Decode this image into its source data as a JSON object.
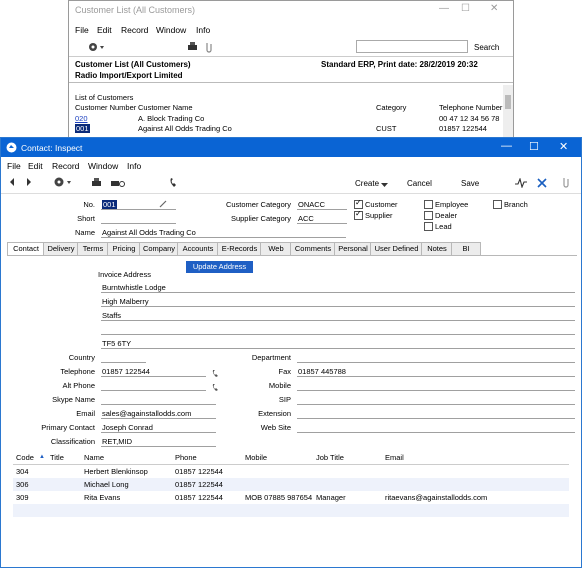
{
  "background_window": {
    "title": "Customer List (All Customers)",
    "menu": [
      "File",
      "Edit",
      "Record",
      "Window",
      "Info"
    ],
    "search_label": "Search",
    "report_title": "Customer List (All Customers)",
    "company": "Radio Import/Export Limited",
    "print_info": "Standard ERP, Print date: 28/2/2019 20:32",
    "list_heading": "List of Customers",
    "columns": [
      "Customer Number",
      "Customer Name",
      "Category",
      "Telephone Number"
    ],
    "rows": [
      {
        "number": "020",
        "name": "A. Block Trading Co",
        "category": "",
        "phone": "00 47 12 34 56 78"
      },
      {
        "number": "001",
        "name": "Against All Odds Trading Co",
        "category": "CUST",
        "phone": "01857 122544"
      }
    ]
  },
  "window": {
    "title": "Contact: Inspect",
    "menu": [
      "File",
      "Edit",
      "Record",
      "Window",
      "Info"
    ],
    "toolbar": {
      "create": "Create",
      "cancel": "Cancel",
      "save": "Save"
    }
  },
  "header": {
    "no_label": "No.",
    "no_value": "001",
    "short_label": "Short",
    "short_value": "",
    "name_label": "Name",
    "name_value": "Against All Odds Trading Co",
    "cust_cat_label": "Customer Category",
    "cust_cat_value": "ONACC",
    "supp_cat_label": "Supplier Category",
    "supp_cat_value": "ACC",
    "checkboxes": [
      {
        "label": "Customer",
        "checked": true
      },
      {
        "label": "Supplier",
        "checked": true
      },
      {
        "label": "Employee",
        "checked": false
      },
      {
        "label": "Dealer",
        "checked": false
      },
      {
        "label": "Lead",
        "checked": false
      },
      {
        "label": "Branch",
        "checked": false
      }
    ]
  },
  "tabs": [
    "Contact",
    "Delivery",
    "Terms",
    "Pricing",
    "Company",
    "Accounts",
    "E-Records",
    "Web",
    "Comments",
    "Personal",
    "User Defined",
    "Notes",
    "BI"
  ],
  "contact": {
    "invoice_address_label": "Invoice Address",
    "update_address": "Update Address",
    "address_lines": [
      "Burntwhistle Lodge",
      "High Malberry",
      "Staffs",
      "",
      "TF5 6TY"
    ],
    "country_label": "Country",
    "country": "",
    "telephone_label": "Telephone",
    "telephone": "01857 122544",
    "alt_phone_label": "Alt Phone",
    "alt_phone": "",
    "skype_label": "Skype Name",
    "skype": "",
    "email_label": "Email",
    "email": "sales@againstallodds.com",
    "primary_contact_label": "Primary Contact",
    "primary_contact": "Joseph Conrad",
    "classification_label": "Classification",
    "classification": "RET,MID",
    "department_label": "Department",
    "department": "",
    "fax_label": "Fax",
    "fax": "01857 445788",
    "mobile_label": "Mobile",
    "mobile": "",
    "sip_label": "SIP",
    "sip": "",
    "extension_label": "Extension",
    "extension": "",
    "website_label": "Web Site",
    "website": ""
  },
  "contacts_table": {
    "columns": [
      "Code",
      "Title",
      "Name",
      "Phone",
      "Mobile",
      "Job Title",
      "Email"
    ],
    "rows": [
      {
        "code": "304",
        "title": "",
        "name": "Herbert Blenkinsop",
        "phone": "01857 122544",
        "mobile": "",
        "job": "",
        "email": ""
      },
      {
        "code": "306",
        "title": "",
        "name": "Michael Long",
        "phone": "01857 122544",
        "mobile": "",
        "job": "",
        "email": ""
      },
      {
        "code": "309",
        "title": "",
        "name": "Rita Evans",
        "phone": "01857 122544",
        "mobile": "MOB 07885 987654",
        "job": "Manager",
        "email": "ritaevans@againstallodds.com"
      }
    ]
  }
}
